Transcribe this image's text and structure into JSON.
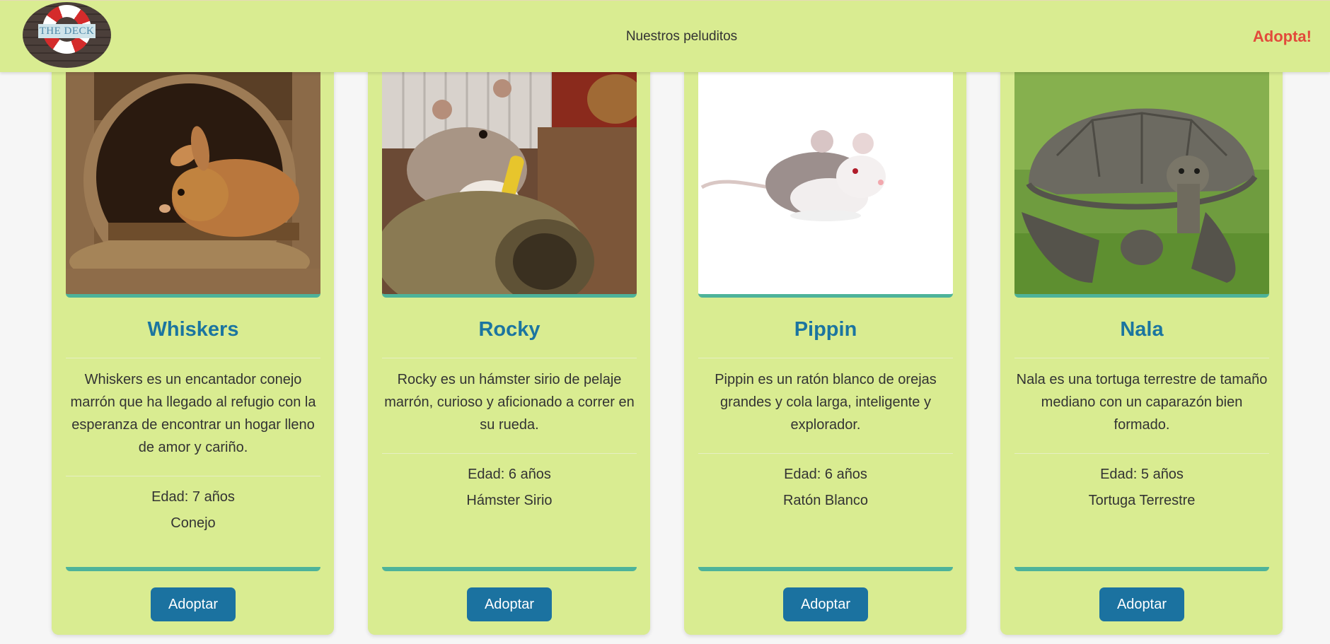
{
  "header": {
    "logo_text": "THE DECK",
    "nav_title": "Nuestros peluditos",
    "adopt_link": "Adopta!"
  },
  "pets": [
    {
      "name": "Whiskers",
      "description": "Whiskers es un encantador conejo marrón que ha llegado al refugio con la esperanza de encontrar un hogar lleno de amor y cariño.",
      "age": "Edad: 7 años",
      "species": "Conejo",
      "button": "Adoptar",
      "photo": "rabbit-in-log-photo"
    },
    {
      "name": "Rocky",
      "description": "Rocky es un hámster sirio de pelaje marrón, curioso y aficionado a correr en su rueda.",
      "age": "Edad: 6 años",
      "species": "Hámster Sirio",
      "button": "Adoptar",
      "photo": "hamster-eating-photo"
    },
    {
      "name": "Pippin",
      "description": "Pippin es un ratón blanco de orejas grandes y cola larga, inteligente y explorador.",
      "age": "Edad: 6 años",
      "species": "Ratón Blanco",
      "button": "Adoptar",
      "photo": "white-mouse-photo"
    },
    {
      "name": "Nala",
      "description": "Nala es una tortuga terrestre de tamaño mediano con un caparazón bien formado.",
      "age": "Edad: 5 años",
      "species": "Tortuga Terrestre",
      "button": "Adoptar",
      "photo": "tortoise-on-grass-photo"
    }
  ],
  "colors": {
    "header_bg": "#d9ec91",
    "card_bg": "#d9ec91",
    "title_blue": "#1b75a0",
    "button_blue": "#1b72a0",
    "accent_teal": "#4db39a",
    "adopt_red": "#e24a3b"
  }
}
